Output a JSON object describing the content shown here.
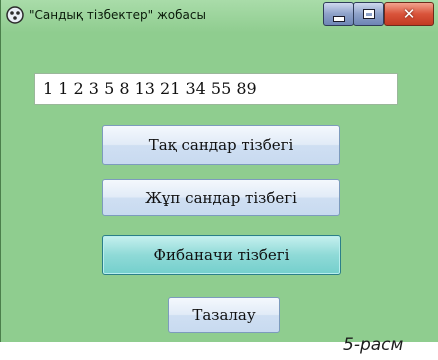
{
  "window": {
    "title": "\"Сандық тізбектер\" жобасы",
    "icon": "app-icon",
    "controls": {
      "minimize": "minimize-icon",
      "maximize": "maximize-icon",
      "close": "close-icon"
    }
  },
  "output": {
    "value": "1 1 2 3 5 8 13 21 34 55 89"
  },
  "buttons": {
    "odd": "Тақ сандар тізбегі",
    "even": "Жұп сандар тізбегі",
    "fibonacci": "Фибаначи тізбегі",
    "clear": "Тазалау"
  },
  "caption": "5-расм",
  "colors": {
    "window_bg": "#8fcd8f",
    "button_bg": "#dce8f5",
    "active_button_bg": "#8fdad7",
    "close_button": "#d9533a"
  }
}
